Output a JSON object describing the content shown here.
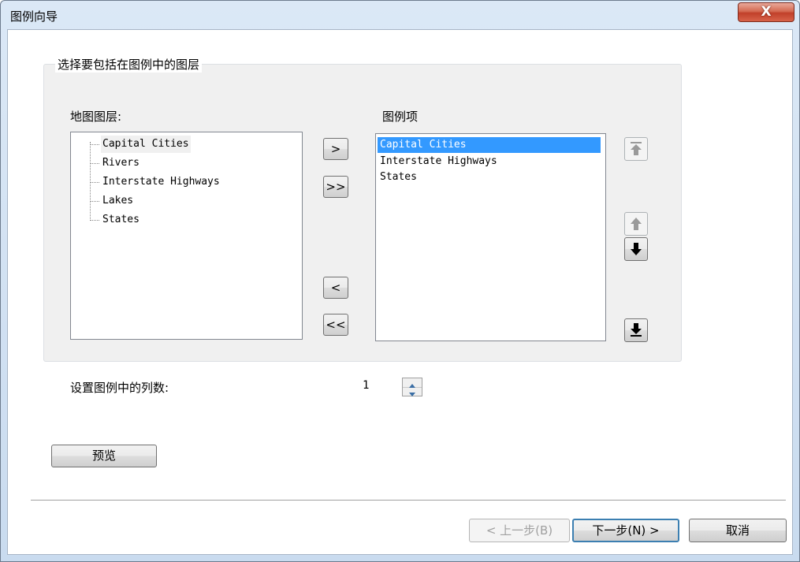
{
  "window": {
    "title": "图例向导",
    "close_label": "X"
  },
  "group": {
    "title": "选择要包括在图例中的图层",
    "map_layers_label": "地图图层:",
    "legend_items_label": "图例项"
  },
  "map_layers": [
    {
      "label": "Capital Cities"
    },
    {
      "label": "Rivers"
    },
    {
      "label": "Interstate Highways"
    },
    {
      "label": "Lakes"
    },
    {
      "label": "States"
    }
  ],
  "legend_items": [
    {
      "label": "Capital Cities",
      "selected": true
    },
    {
      "label": "Interstate Highways",
      "selected": false
    },
    {
      "label": "States",
      "selected": false
    }
  ],
  "transfer_buttons": {
    "add": ">",
    "add_all": ">>",
    "remove": "<",
    "remove_all": "<<"
  },
  "order_buttons": {
    "move_top_icon": "arrow-to-top-icon",
    "move_up_icon": "arrow-up-icon",
    "move_down_icon": "arrow-down-icon",
    "move_bottom_icon": "arrow-to-bottom-icon"
  },
  "columns": {
    "label": "设置图例中的列数:",
    "value": "1"
  },
  "preview_label": "预览",
  "footer": {
    "back_label": "< 上一步(B)",
    "next_label": "下一步(N) >",
    "cancel_label": "取消"
  },
  "colors": {
    "selection": "#3399ff",
    "close_button": "#c1402a",
    "titlebar": "#c9dbef"
  }
}
